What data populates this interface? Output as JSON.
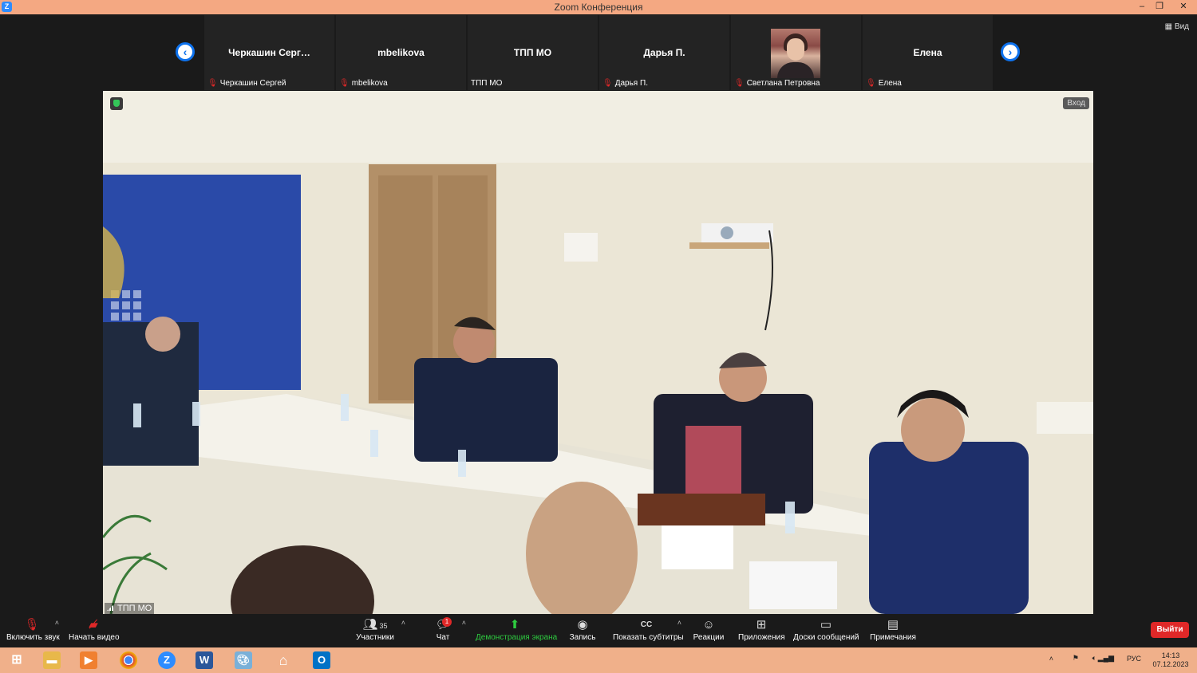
{
  "window": {
    "title": "Zoom Конференция",
    "controls": [
      "minimize",
      "restore",
      "close"
    ]
  },
  "view_button": "Вид",
  "strip": {
    "prev_label": "‹",
    "next_label": "›",
    "tiles": [
      {
        "name": "Черкашин  Серг…",
        "label": "Черкашин Сергей",
        "muted": true
      },
      {
        "name": "mbelikova",
        "label": "mbelikova",
        "muted": true
      },
      {
        "name": "ТПП МО",
        "label": "ТПП МО",
        "muted": false
      },
      {
        "name": "Дарья П.",
        "label": "Дарья П.",
        "muted": true
      },
      {
        "name": "",
        "label": "Светлана Петровна",
        "muted": true,
        "has_photo": true
      },
      {
        "name": "Елена",
        "label": "Елена",
        "muted": true
      }
    ]
  },
  "main_video": {
    "enter_label": "Вход",
    "speaker_label": "ТПП МО"
  },
  "toolbar": {
    "unmute": "Включить звук",
    "start_video": "Начать видео",
    "participants": "Участники",
    "participants_count": "35",
    "chat": "Чат",
    "chat_badge": "1",
    "share": "Демонстрация экрана",
    "record": "Запись",
    "captions": "Показать субтитры",
    "captions_icon": "CC",
    "reactions": "Реакции",
    "apps": "Приложения",
    "whiteboards": "Доски сообщений",
    "notes": "Примечания",
    "leave": "Выйти"
  },
  "taskbar": {
    "lang": "РУС",
    "time": "14:13",
    "date": "07.12.2023",
    "apps": [
      "windows-start",
      "file-explorer",
      "media-player",
      "chrome",
      "zoom",
      "word",
      "paint",
      "home",
      "outlook"
    ]
  },
  "colors": {
    "zoom_blue": "#0e72ed",
    "mute_red": "#e02828",
    "share_green": "#2ecc40",
    "taskbar": "#f0b08a"
  }
}
